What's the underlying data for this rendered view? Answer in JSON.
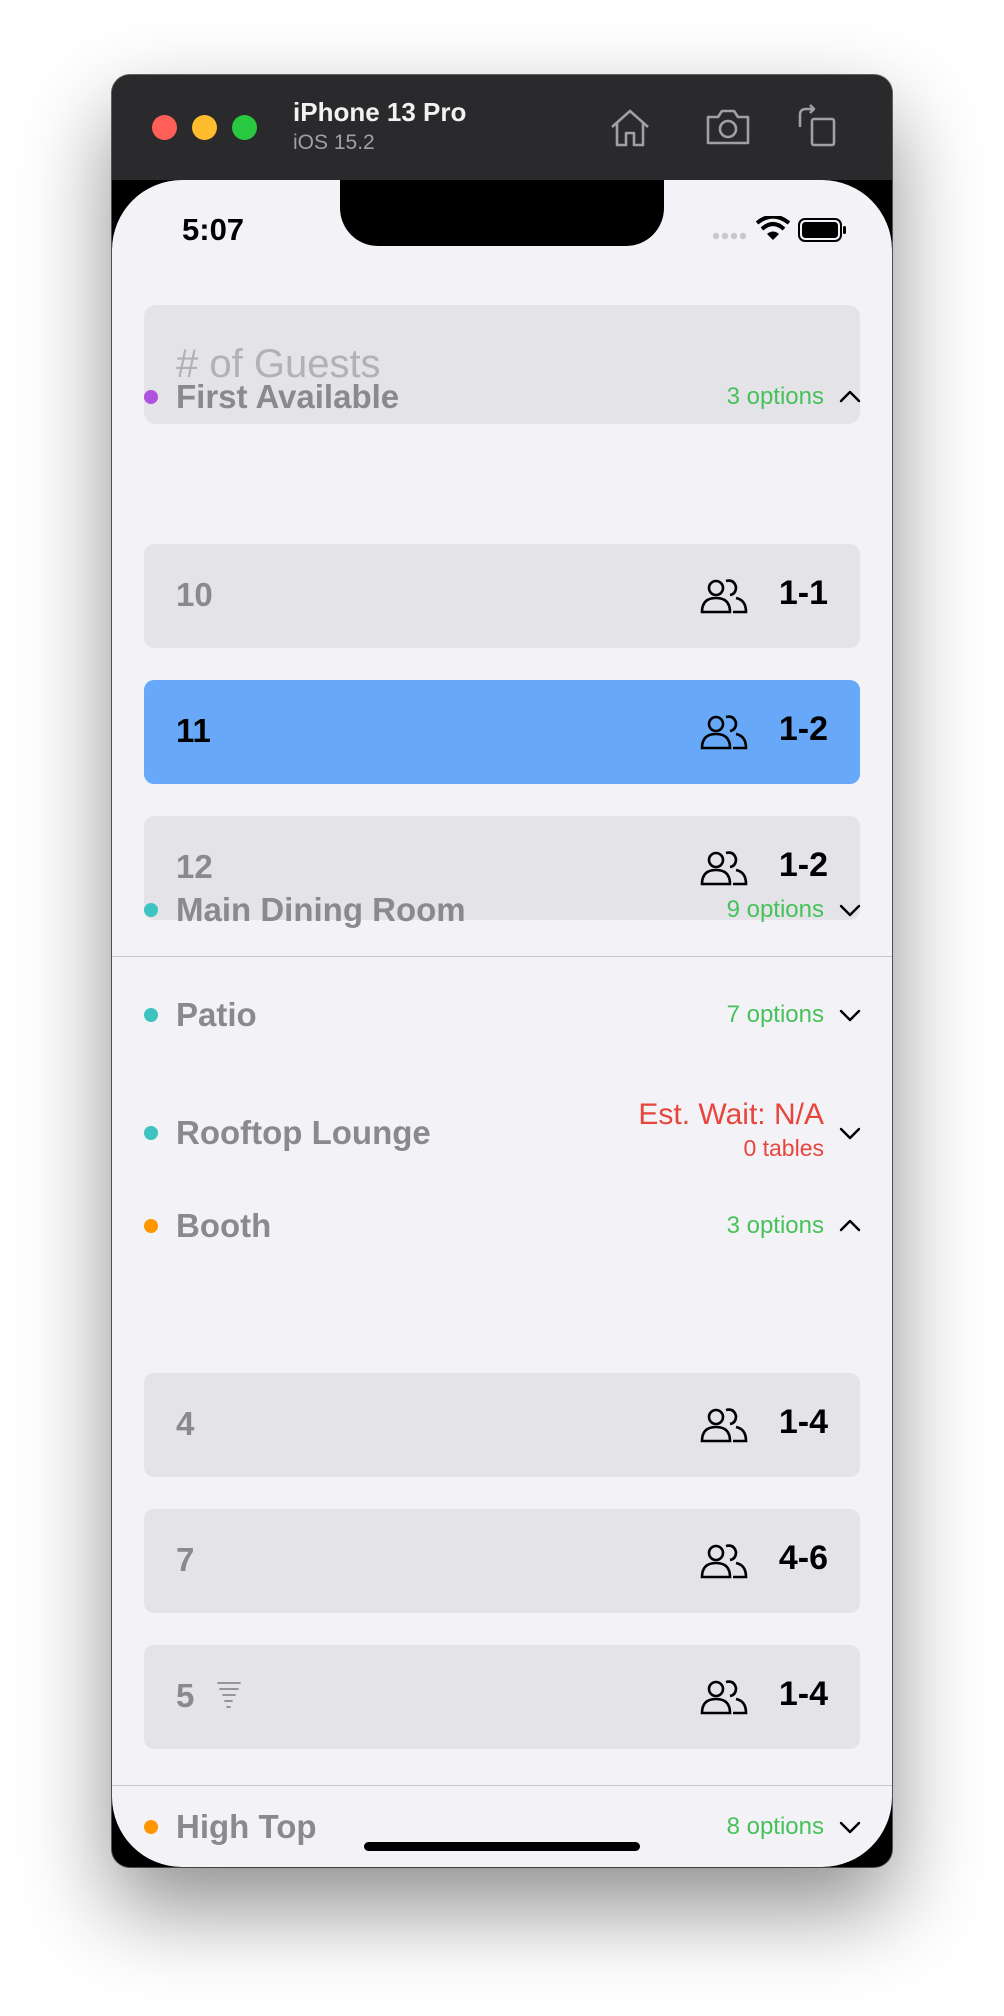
{
  "simulator": {
    "device_name": "iPhone 13 Pro",
    "os_version": "iOS 15.2"
  },
  "status_bar": {
    "time": "5:07"
  },
  "guests_field": {
    "placeholder": "# of Guests",
    "value": ""
  },
  "colors": {
    "purple_dot": "#af52de",
    "teal_dot": "#3dc4c0",
    "orange_dot": "#ff9500",
    "options_green": "#47c25a",
    "wait_red": "#e8453c",
    "selected_blue": "#67a9f8"
  },
  "sections": {
    "first_available": {
      "title": "First Available",
      "meta": "3 options",
      "expanded": true,
      "rows": [
        {
          "table": "10",
          "capacity": "1-1",
          "selected": false
        },
        {
          "table": "11",
          "capacity": "1-2",
          "selected": true
        },
        {
          "table": "12",
          "capacity": "1-2",
          "selected": false
        }
      ]
    },
    "main_dining": {
      "title": "Main Dining Room",
      "meta": "9 options",
      "expanded": false
    },
    "patio": {
      "title": "Patio",
      "meta": "7 options",
      "expanded": false
    },
    "rooftop": {
      "title": "Rooftop Lounge",
      "wait": "Est. Wait: N/A",
      "tables": "0 tables",
      "expanded": false
    },
    "booth": {
      "title": "Booth",
      "meta": "3 options",
      "expanded": true,
      "rows": [
        {
          "table": "4",
          "capacity": "1-4"
        },
        {
          "table": "7",
          "capacity": "4-6"
        },
        {
          "table": "5",
          "capacity": "1-4",
          "icon": "tornado-icon"
        }
      ]
    },
    "high_top": {
      "title": "High Top",
      "meta": "8 options",
      "expanded": false
    }
  }
}
